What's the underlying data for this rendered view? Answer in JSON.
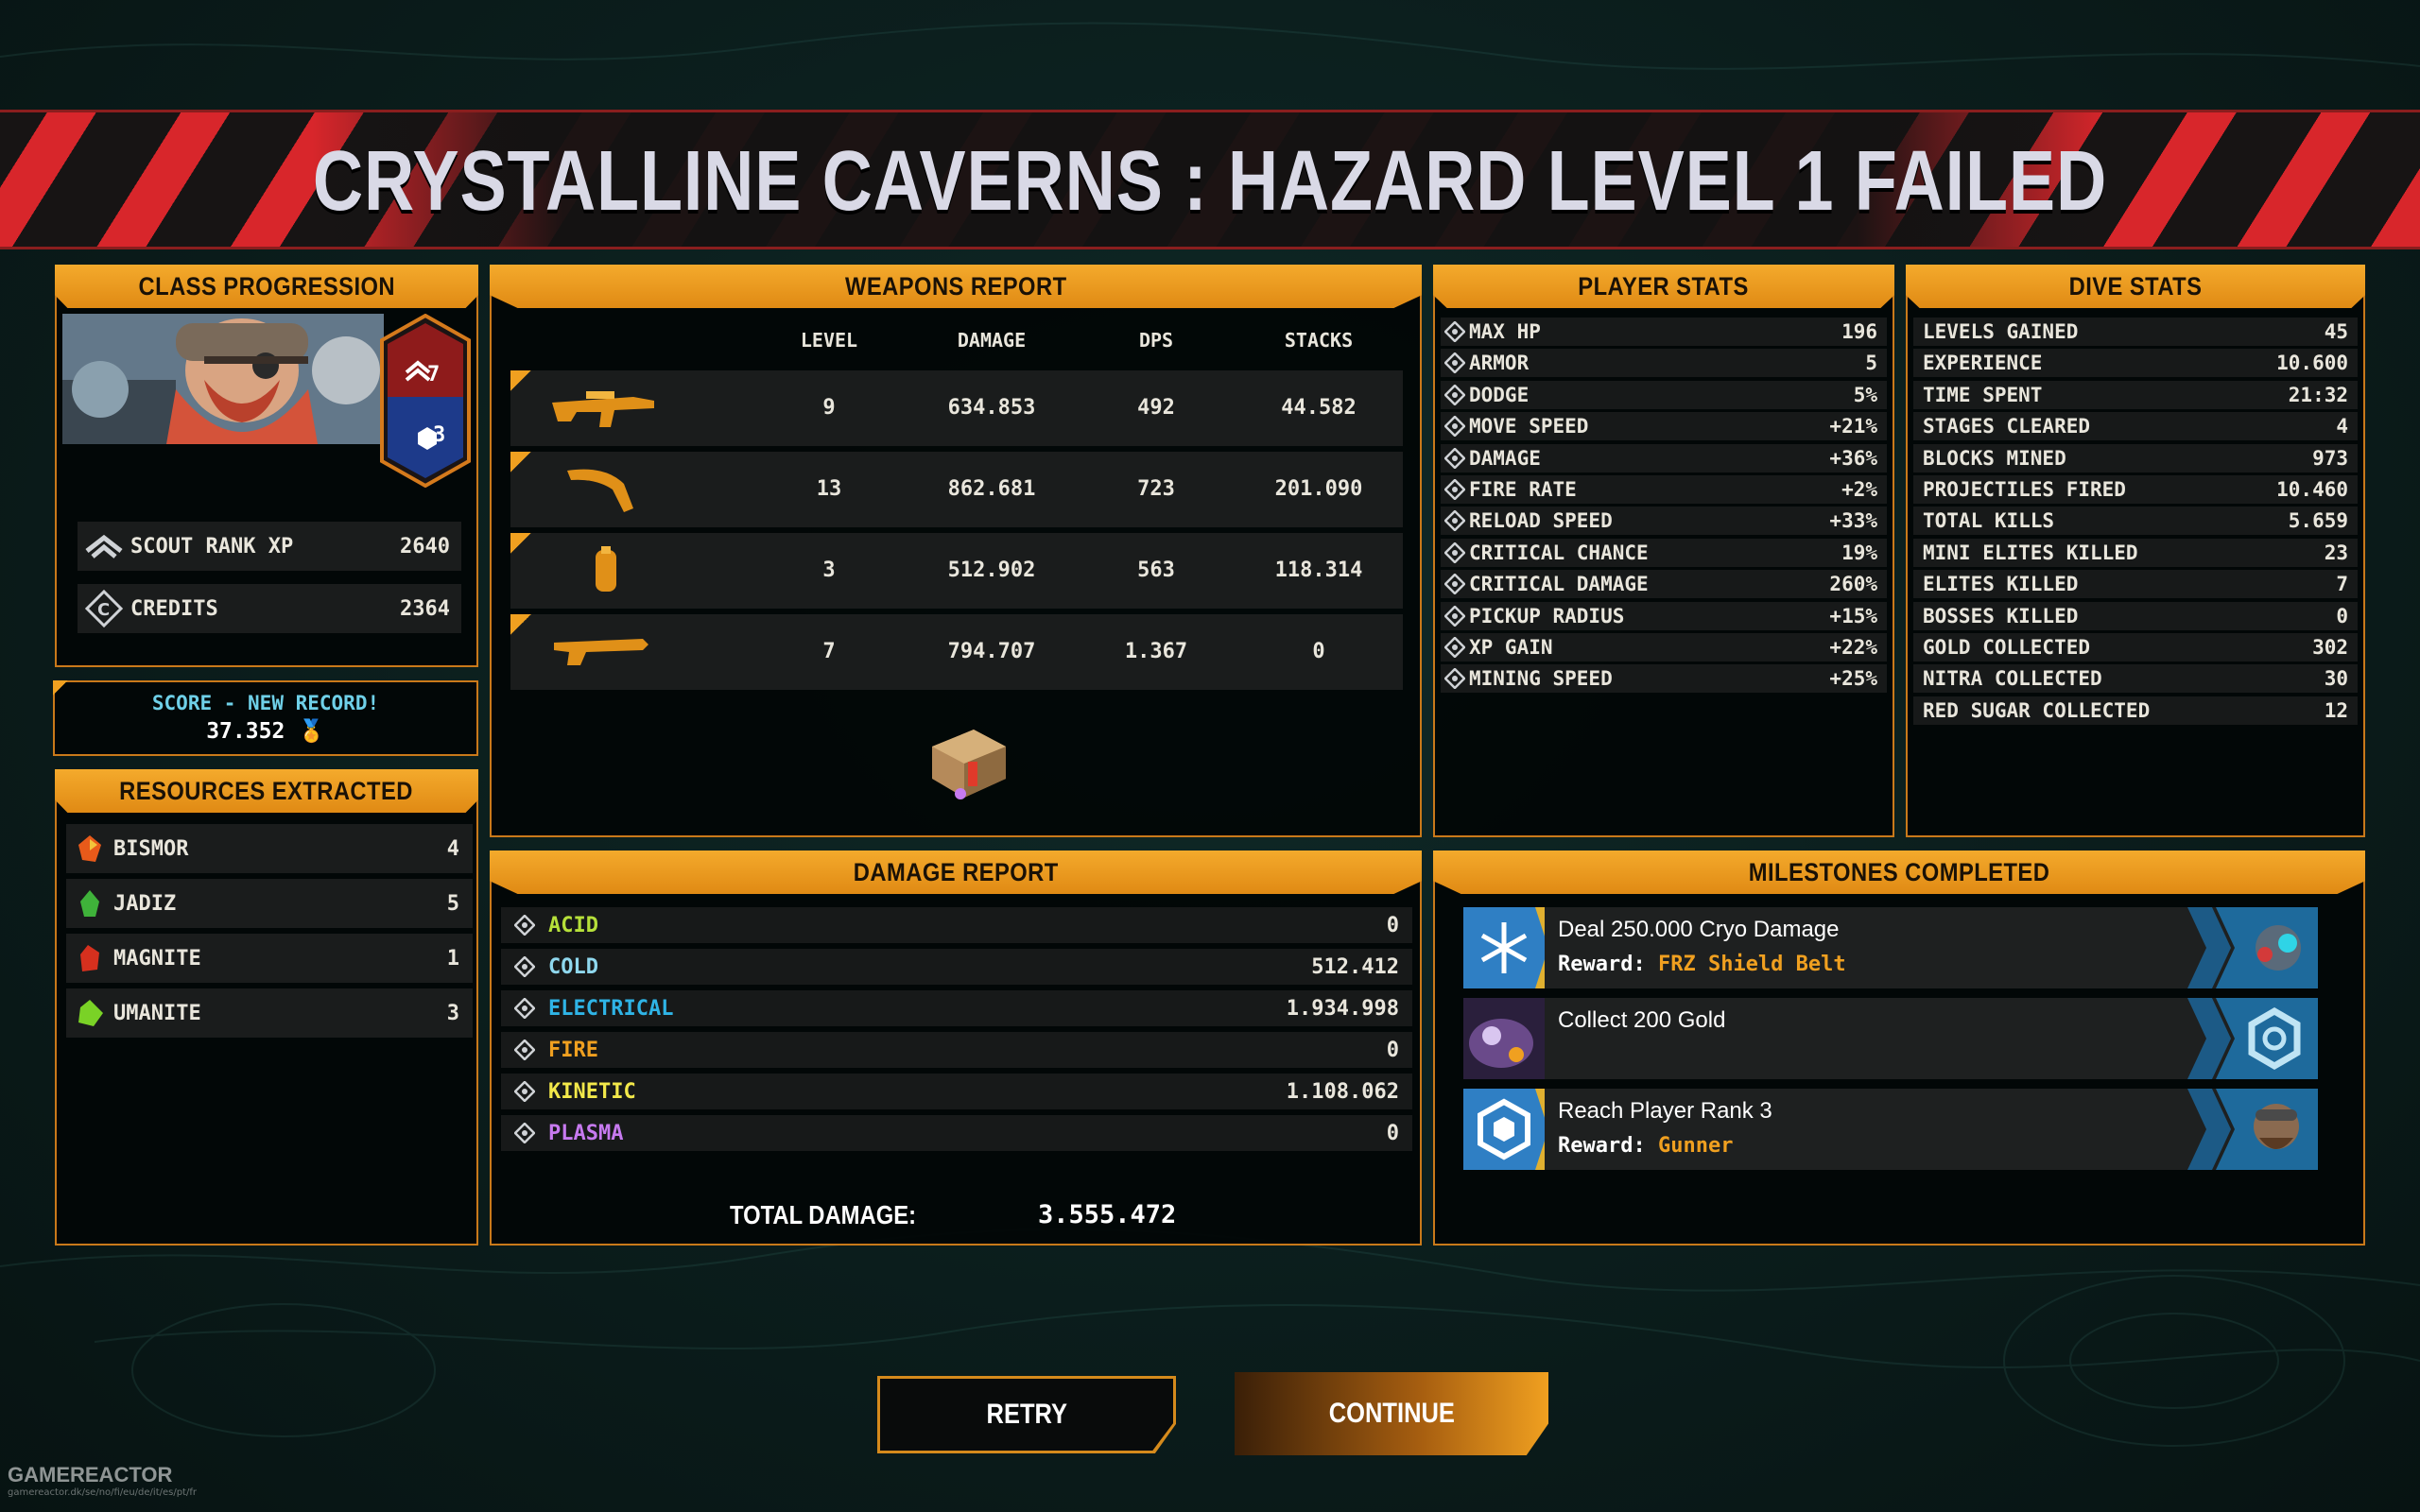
{
  "banner": {
    "title": "CRYSTALLINE CAVERNS : HAZARD LEVEL 1 FAILED"
  },
  "class_progression": {
    "title": "CLASS PROGRESSION",
    "rank_badge": "7",
    "level_badge": "3",
    "rows": [
      {
        "icon": "scout-rank-icon",
        "label": "SCOUT RANK XP",
        "value": "2640"
      },
      {
        "icon": "credits-icon",
        "label": "CREDITS",
        "value": "2364"
      }
    ]
  },
  "score": {
    "title": "SCORE - NEW RECORD!",
    "value": "37.352"
  },
  "resources": {
    "title": "RESOURCES EXTRACTED",
    "items": [
      {
        "icon": "bismor-icon",
        "label": "BISMOR",
        "value": "4",
        "color": "#e85a1a"
      },
      {
        "icon": "jadiz-icon",
        "label": "JADIZ",
        "value": "5",
        "color": "#3fb23a"
      },
      {
        "icon": "magnite-icon",
        "label": "MAGNITE",
        "value": "1",
        "color": "#d6301e"
      },
      {
        "icon": "umanite-icon",
        "label": "UMANITE",
        "value": "3",
        "color": "#7ad226"
      }
    ]
  },
  "weapons": {
    "title": "WEAPONS REPORT",
    "headers": [
      "LEVEL",
      "DAMAGE",
      "DPS",
      "STACKS"
    ],
    "rows": [
      {
        "icon": "assault-rifle-icon",
        "level": "9",
        "damage": "634.853",
        "dps": "492",
        "stacks": "44.582"
      },
      {
        "icon": "pickaxe-weapon-icon",
        "level": "13",
        "damage": "862.681",
        "dps": "723",
        "stacks": "201.090"
      },
      {
        "icon": "grenade-canister-icon",
        "level": "3",
        "damage": "512.902",
        "dps": "563",
        "stacks": "118.314"
      },
      {
        "icon": "shotgun-icon",
        "level": "7",
        "damage": "794.707",
        "dps": "1.367",
        "stacks": "0"
      }
    ]
  },
  "player_stats": {
    "title": "PLAYER STATS",
    "rows": [
      {
        "icon": "max-hp-icon",
        "label": "MAX HP",
        "value": "196"
      },
      {
        "icon": "armor-icon",
        "label": "ARMOR",
        "value": "5"
      },
      {
        "icon": "dodge-icon",
        "label": "DODGE",
        "value": "5%"
      },
      {
        "icon": "move-speed-icon",
        "label": "MOVE SPEED",
        "value": "+21%"
      },
      {
        "icon": "damage-icon",
        "label": "DAMAGE",
        "value": "+36%"
      },
      {
        "icon": "fire-rate-icon",
        "label": "FIRE RATE",
        "value": "+2%"
      },
      {
        "icon": "reload-speed-icon",
        "label": "RELOAD SPEED",
        "value": "+33%"
      },
      {
        "icon": "critical-chance-icon",
        "label": "CRITICAL CHANCE",
        "value": "19%"
      },
      {
        "icon": "critical-damage-icon",
        "label": "CRITICAL DAMAGE",
        "value": "260%"
      },
      {
        "icon": "pickup-radius-icon",
        "label": "PICKUP RADIUS",
        "value": "+15%"
      },
      {
        "icon": "xp-gain-icon",
        "label": "XP GAIN",
        "value": "+22%"
      },
      {
        "icon": "mining-speed-icon",
        "label": "MINING SPEED",
        "value": "+25%"
      }
    ]
  },
  "dive_stats": {
    "title": "DIVE STATS",
    "rows": [
      {
        "label": "LEVELS GAINED",
        "value": "45"
      },
      {
        "label": "EXPERIENCE",
        "value": "10.600"
      },
      {
        "label": "TIME SPENT",
        "value": "21:32"
      },
      {
        "label": "STAGES CLEARED",
        "value": "4"
      },
      {
        "label": "BLOCKS MINED",
        "value": "973"
      },
      {
        "label": "PROJECTILES FIRED",
        "value": "10.460"
      },
      {
        "label": "TOTAL KILLS",
        "value": "5.659"
      },
      {
        "label": "MINI ELITES KILLED",
        "value": "23"
      },
      {
        "label": "ELITES KILLED",
        "value": "7"
      },
      {
        "label": "BOSSES KILLED",
        "value": "0"
      },
      {
        "label": "GOLD COLLECTED",
        "value": "302"
      },
      {
        "label": "NITRA COLLECTED",
        "value": "30"
      },
      {
        "label": "RED SUGAR COLLECTED",
        "value": "12"
      }
    ]
  },
  "damage_report": {
    "title": "DAMAGE REPORT",
    "rows": [
      {
        "icon": "acid-icon",
        "label": "ACID",
        "value": "0",
        "color": "#b6e03a"
      },
      {
        "icon": "cold-icon",
        "label": "COLD",
        "value": "512.412",
        "color": "#8fd8ee"
      },
      {
        "icon": "electrical-icon",
        "label": "ELECTRICAL",
        "value": "1.934.998",
        "color": "#2fb4e6"
      },
      {
        "icon": "fire-icon",
        "label": "FIRE",
        "value": "0",
        "color": "#f0a020"
      },
      {
        "icon": "kinetic-icon",
        "label": "KINETIC",
        "value": "1.108.062",
        "color": "#f2e84a"
      },
      {
        "icon": "plasma-icon",
        "label": "PLASMA",
        "value": "0",
        "color": "#c77af0"
      }
    ],
    "total_label": "TOTAL DAMAGE:",
    "total_value": "3.555.472"
  },
  "milestones": {
    "title": "MILESTONES COMPLETED",
    "items": [
      {
        "icon": "cryo-snowflake-icon",
        "title": "Deal 250.000 Cryo Damage",
        "reward_label": "Reward:",
        "reward": "FRZ Shield Belt",
        "reward_icon": "shield-belt-icon"
      },
      {
        "icon": "gold-cave-icon",
        "title": "Collect 200 Gold",
        "reward_label": "",
        "reward": "",
        "reward_icon": "hexagon-currency-icon"
      },
      {
        "icon": "player-rank-icon",
        "title": "Reach Player Rank 3",
        "reward_label": "Reward:",
        "reward": "Gunner",
        "reward_icon": "gunner-portrait-icon"
      }
    ]
  },
  "buttons": {
    "retry": "RETRY",
    "continue": "CONTINUE"
  },
  "watermark": {
    "brand": "GAMEREACTOR",
    "sub": "gamereactor.dk/se/no/fi/eu/de/it/es/pt/fr"
  }
}
